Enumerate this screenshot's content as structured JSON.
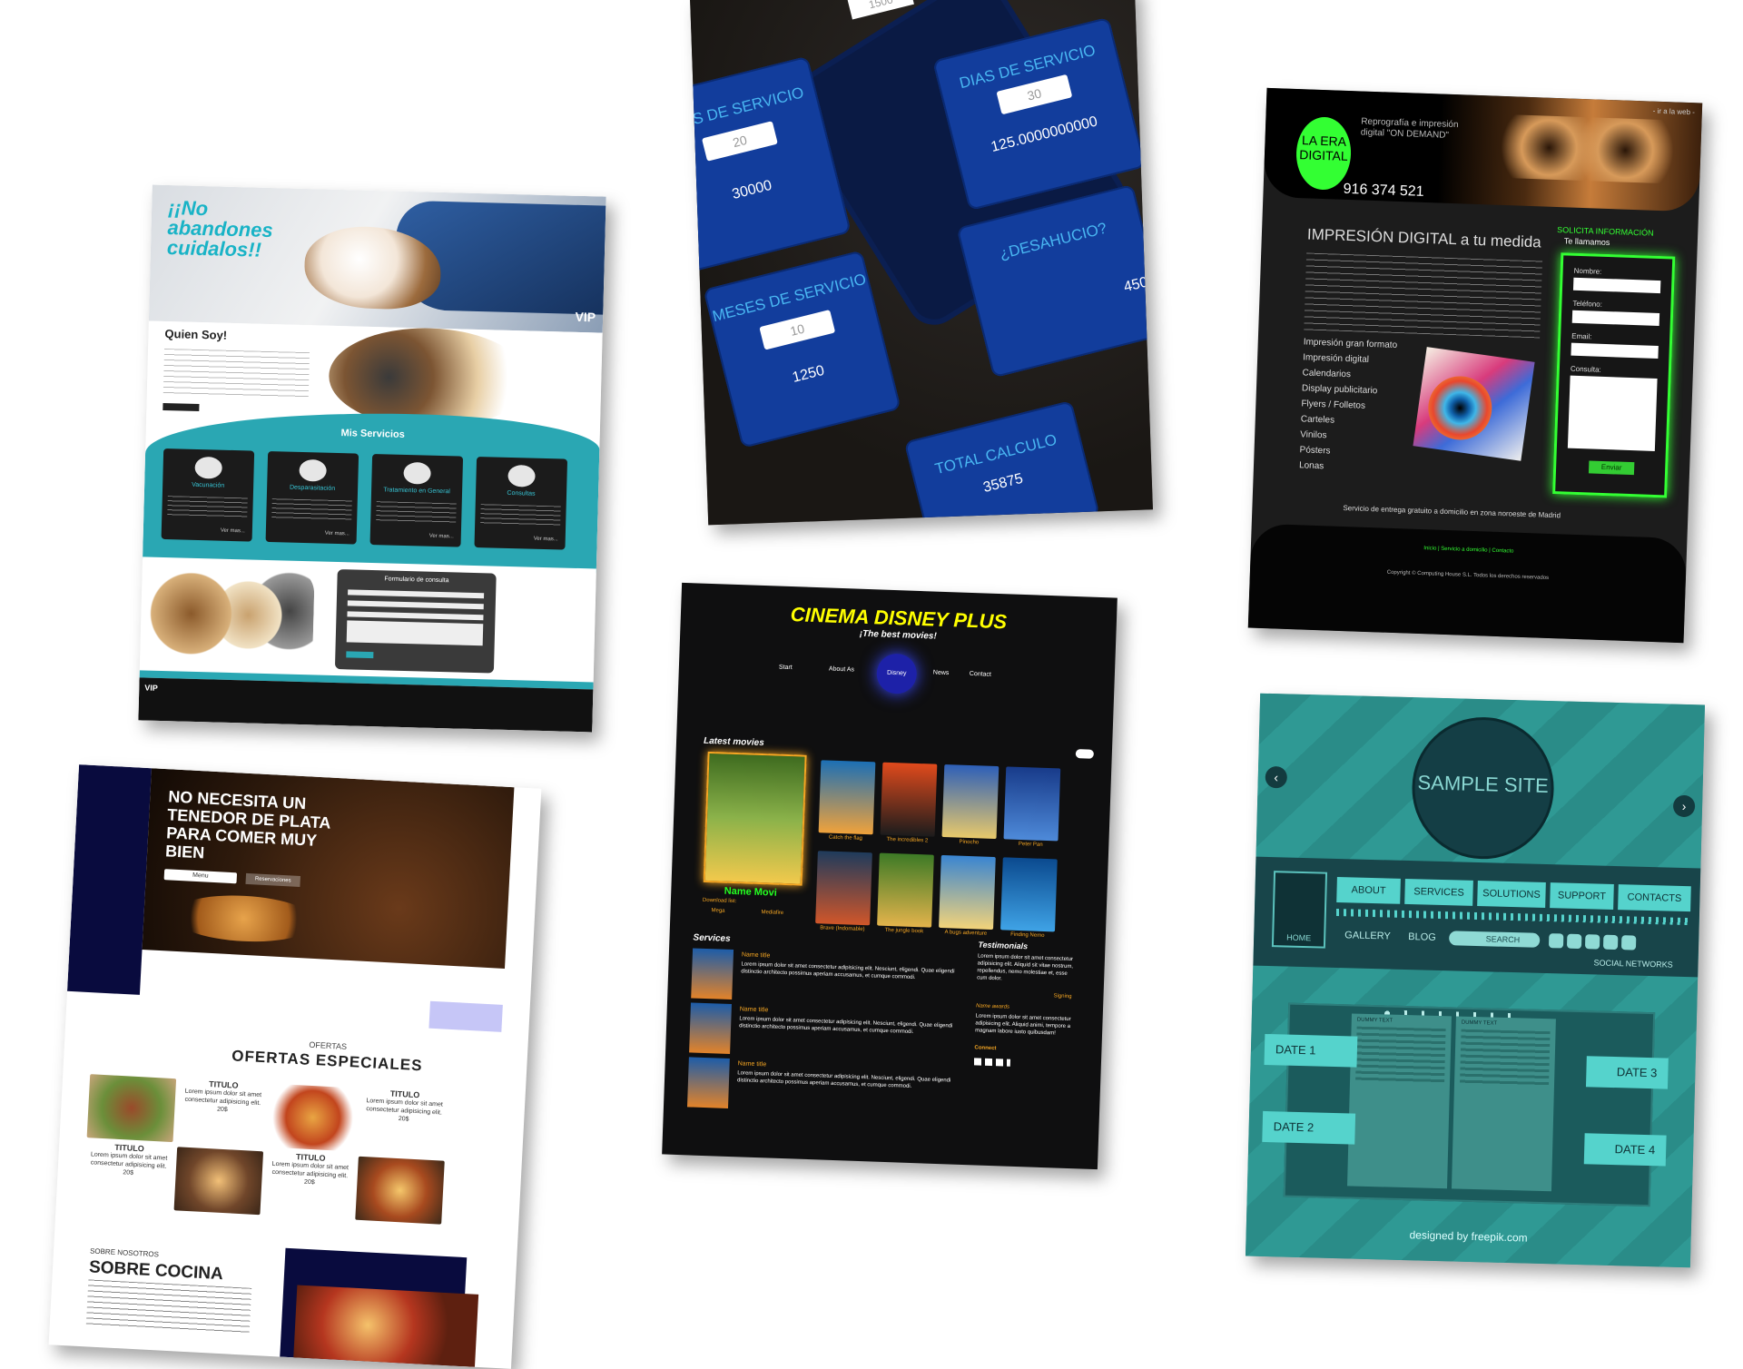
{
  "vet": {
    "hero_title": "¡¡No abandones cuidalos!!",
    "vip": "VIP",
    "about_title": "Quien Soy!",
    "services_title": "Mis Servicios",
    "services": [
      {
        "title": "Vacunación",
        "more": "Ver mas..."
      },
      {
        "title": "Desparasitación",
        "more": "Ver mas..."
      },
      {
        "title": "Tratamiento en General",
        "more": "Ver mas..."
      },
      {
        "title": "Consultas",
        "more": "Ver mas..."
      }
    ],
    "form_title": "Formulario de consulta",
    "footer_vip": "VIP"
  },
  "calc": {
    "tiles": [
      {
        "title": "AÑOS DE SERVICIO",
        "input": "20",
        "value": "30000"
      },
      {
        "title": "DIAS DE SERVICIO",
        "input": "30",
        "value": "125.0000000000"
      },
      {
        "title": "MESES DE SERVICIO",
        "input": "10",
        "value": "1250"
      },
      {
        "title": "¿DESAHUCIO?",
        "input": "",
        "value": "450"
      },
      {
        "title": "TOTAL CALCULO",
        "input": "",
        "value": "35875"
      }
    ],
    "top_input": "1500"
  },
  "era": {
    "logo_line1": "LA ERA",
    "logo_line2": "DIGITAL",
    "tagline": "Reprografía e impresión digital \"ON DEMAND\"",
    "phone": "916 374 521",
    "goto": "- ir a la web -",
    "heading": "IMPRESIÓN DIGITAL a tu medida",
    "services": [
      "Impresión gran formato",
      "Impresión digital",
      "Calendarios",
      "Display publicitario",
      "Flyers / Folletos",
      "Carteles",
      "Vinilos",
      "Pósters",
      "Lonas"
    ],
    "solicita": "SOLICITA INFORMACIÓN",
    "llamamos": "Te llamamos",
    "fields": [
      "Nombre:",
      "Teléfono:",
      "Email:",
      "Consulta:"
    ],
    "send": "Enviar",
    "shipping": "Servicio de entrega gratuito a domicilio en zona noroeste de Madrid",
    "footer_links": "Inicio | Servicio a domicilio | Contacto",
    "footer_copy": "Copyright © Computing House S.L. Todos los derechos reservados"
  },
  "food": {
    "hero_title": "NO NECESITA UN TENEDOR DE PLATA PARA COMER MUY BIEN",
    "hero_btn1": "Menu",
    "hero_btn2": "Reservaciones",
    "offers_small": "OFERTAS",
    "offers_title": "OFERTAS ESPECIALES",
    "items": [
      {
        "title": "TITULO",
        "price": "20$"
      },
      {
        "title": "TITULO",
        "price": "20$"
      },
      {
        "title": "TITULO",
        "price": "20$"
      },
      {
        "title": "TITULO",
        "price": "20$"
      }
    ],
    "lorem": "Lorem ipsum dolor sit amet consectetur adipisicing elit.",
    "about_small": "SOBRE NOSOTROS",
    "about_title": "SOBRE COCINA"
  },
  "cinema": {
    "title": "CINEMA DISNEY PLUS",
    "subtitle": "¡The best movies!",
    "nav": [
      "Start",
      "About As",
      "News",
      "Contact"
    ],
    "logo": "Disney",
    "latest": "Latest movies",
    "featured_name": "Name Movi",
    "download": "Download list:",
    "mega": "Mega",
    "mediafire": "Mediafire",
    "posters": [
      {
        "title": "Catch the flag",
        "c1": "#1c6fb5",
        "c2": "#f0a23b"
      },
      {
        "title": "The incredibles 2",
        "c1": "#e04a1c",
        "c2": "#1c1c1c"
      },
      {
        "title": "Pinocho",
        "c1": "#2d5fb8",
        "c2": "#e8c96b"
      },
      {
        "title": "Peter Pan",
        "c1": "#183b8a",
        "c2": "#4e8ad9"
      },
      {
        "title": "Brave (Indomable)",
        "c1": "#1f3b5c",
        "c2": "#d0562a"
      },
      {
        "title": "The jungle book",
        "c1": "#3d7a26",
        "c2": "#e3b34b"
      },
      {
        "title": "A bugs adventure",
        "c1": "#3a85d1",
        "c2": "#f2d37a"
      },
      {
        "title": "Finding Nemo",
        "c1": "#0b4a8f",
        "c2": "#3fa3e6"
      }
    ],
    "services": "Services",
    "service_items": [
      {
        "title": "Name title",
        "text": "Lorem ipsum dolor sit amet consectetur adipisicing elit. Nesciunt, eligendi. Quae eligendi distinctio architecto possimus aperiam accusamus, et cumque commodi."
      },
      {
        "title": "Name title",
        "text": "Lorem ipsum dolor sit amet consectetur adipisicing elit. Nesciunt, eligendi. Quae eligendi distinctio architecto possimus aperiam accusamus, et cumque commodi."
      },
      {
        "title": "Name title",
        "text": "Lorem ipsum dolor sit amet consectetur adipisicing elit. Nesciunt, eligendi. Quae eligendi distinctio architecto possimus aperiam accusamus, et cumque commodi."
      }
    ],
    "testimonials": "Testimonials",
    "testimonial_text": "Lorem ipsum dolor sit amet consectetur adipisicing elit. Aliquid sit vitae nostrum, repellendus, nemo molestiae et, esse cum dolor.",
    "signing": "Signing",
    "name_awards": "Name awards",
    "awards_text": "Lorem ipsum dolor sit amet consectetur adipisicing elit. Aliquid animi, tempore a magnam labore iusto quibusdam!",
    "connect": "Connect"
  },
  "sample": {
    "site": "SAMPLE SITE",
    "home": "HOME",
    "tabs": [
      "ABOUT",
      "SERVICES",
      "SOLUTIONS",
      "SUPPORT",
      "CONTACTS"
    ],
    "gallery": "GALLERY",
    "blog": "BLOG",
    "search": "SEARCH",
    "social": "SOCIAL NETWORKS",
    "dummy": "DUMMY TEXT",
    "dates": [
      "DATE 1",
      "DATE 2",
      "DATE 3",
      "DATE 4"
    ],
    "footer": "designed by freepik.com"
  }
}
